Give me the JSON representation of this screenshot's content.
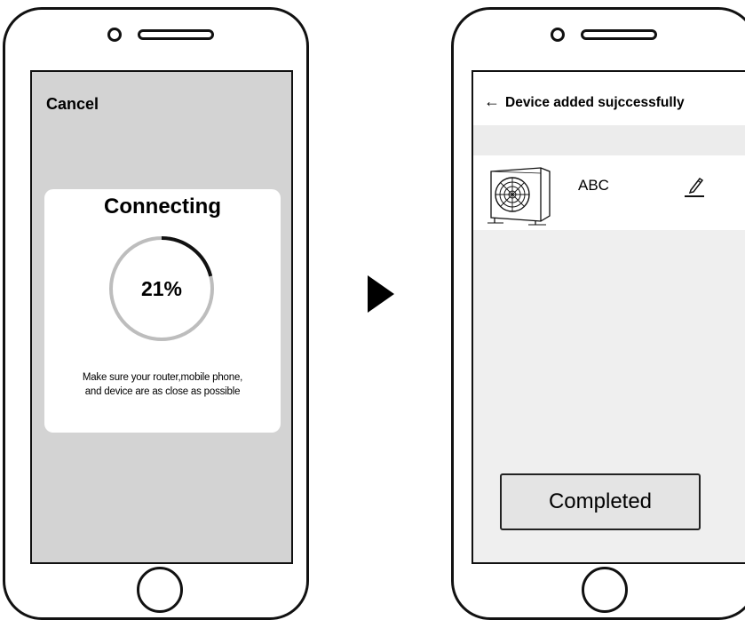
{
  "connecting_screen": {
    "cancel_label": "Cancel",
    "dialog": {
      "title": "Connecting",
      "progress_percent": 21,
      "progress_label": "21%",
      "hint_line1": "Make sure your router,mobile phone,",
      "hint_line2": "and device are as close as possible"
    }
  },
  "success_screen": {
    "header": {
      "back_icon": "arrow-left-icon",
      "title": "Device added sujccessfully"
    },
    "device": {
      "name": "ABC",
      "thumbnail_icon": "heat-pump-unit-icon",
      "edit_icon": "pencil-icon"
    },
    "completed_button_label": "Completed"
  },
  "colors": {
    "screen_grey": "#d3d3d3",
    "screen_light": "#efefef",
    "progress_track": "#bdbdbd",
    "progress_fill": "#111111",
    "button_bg": "#e4e4e4"
  }
}
